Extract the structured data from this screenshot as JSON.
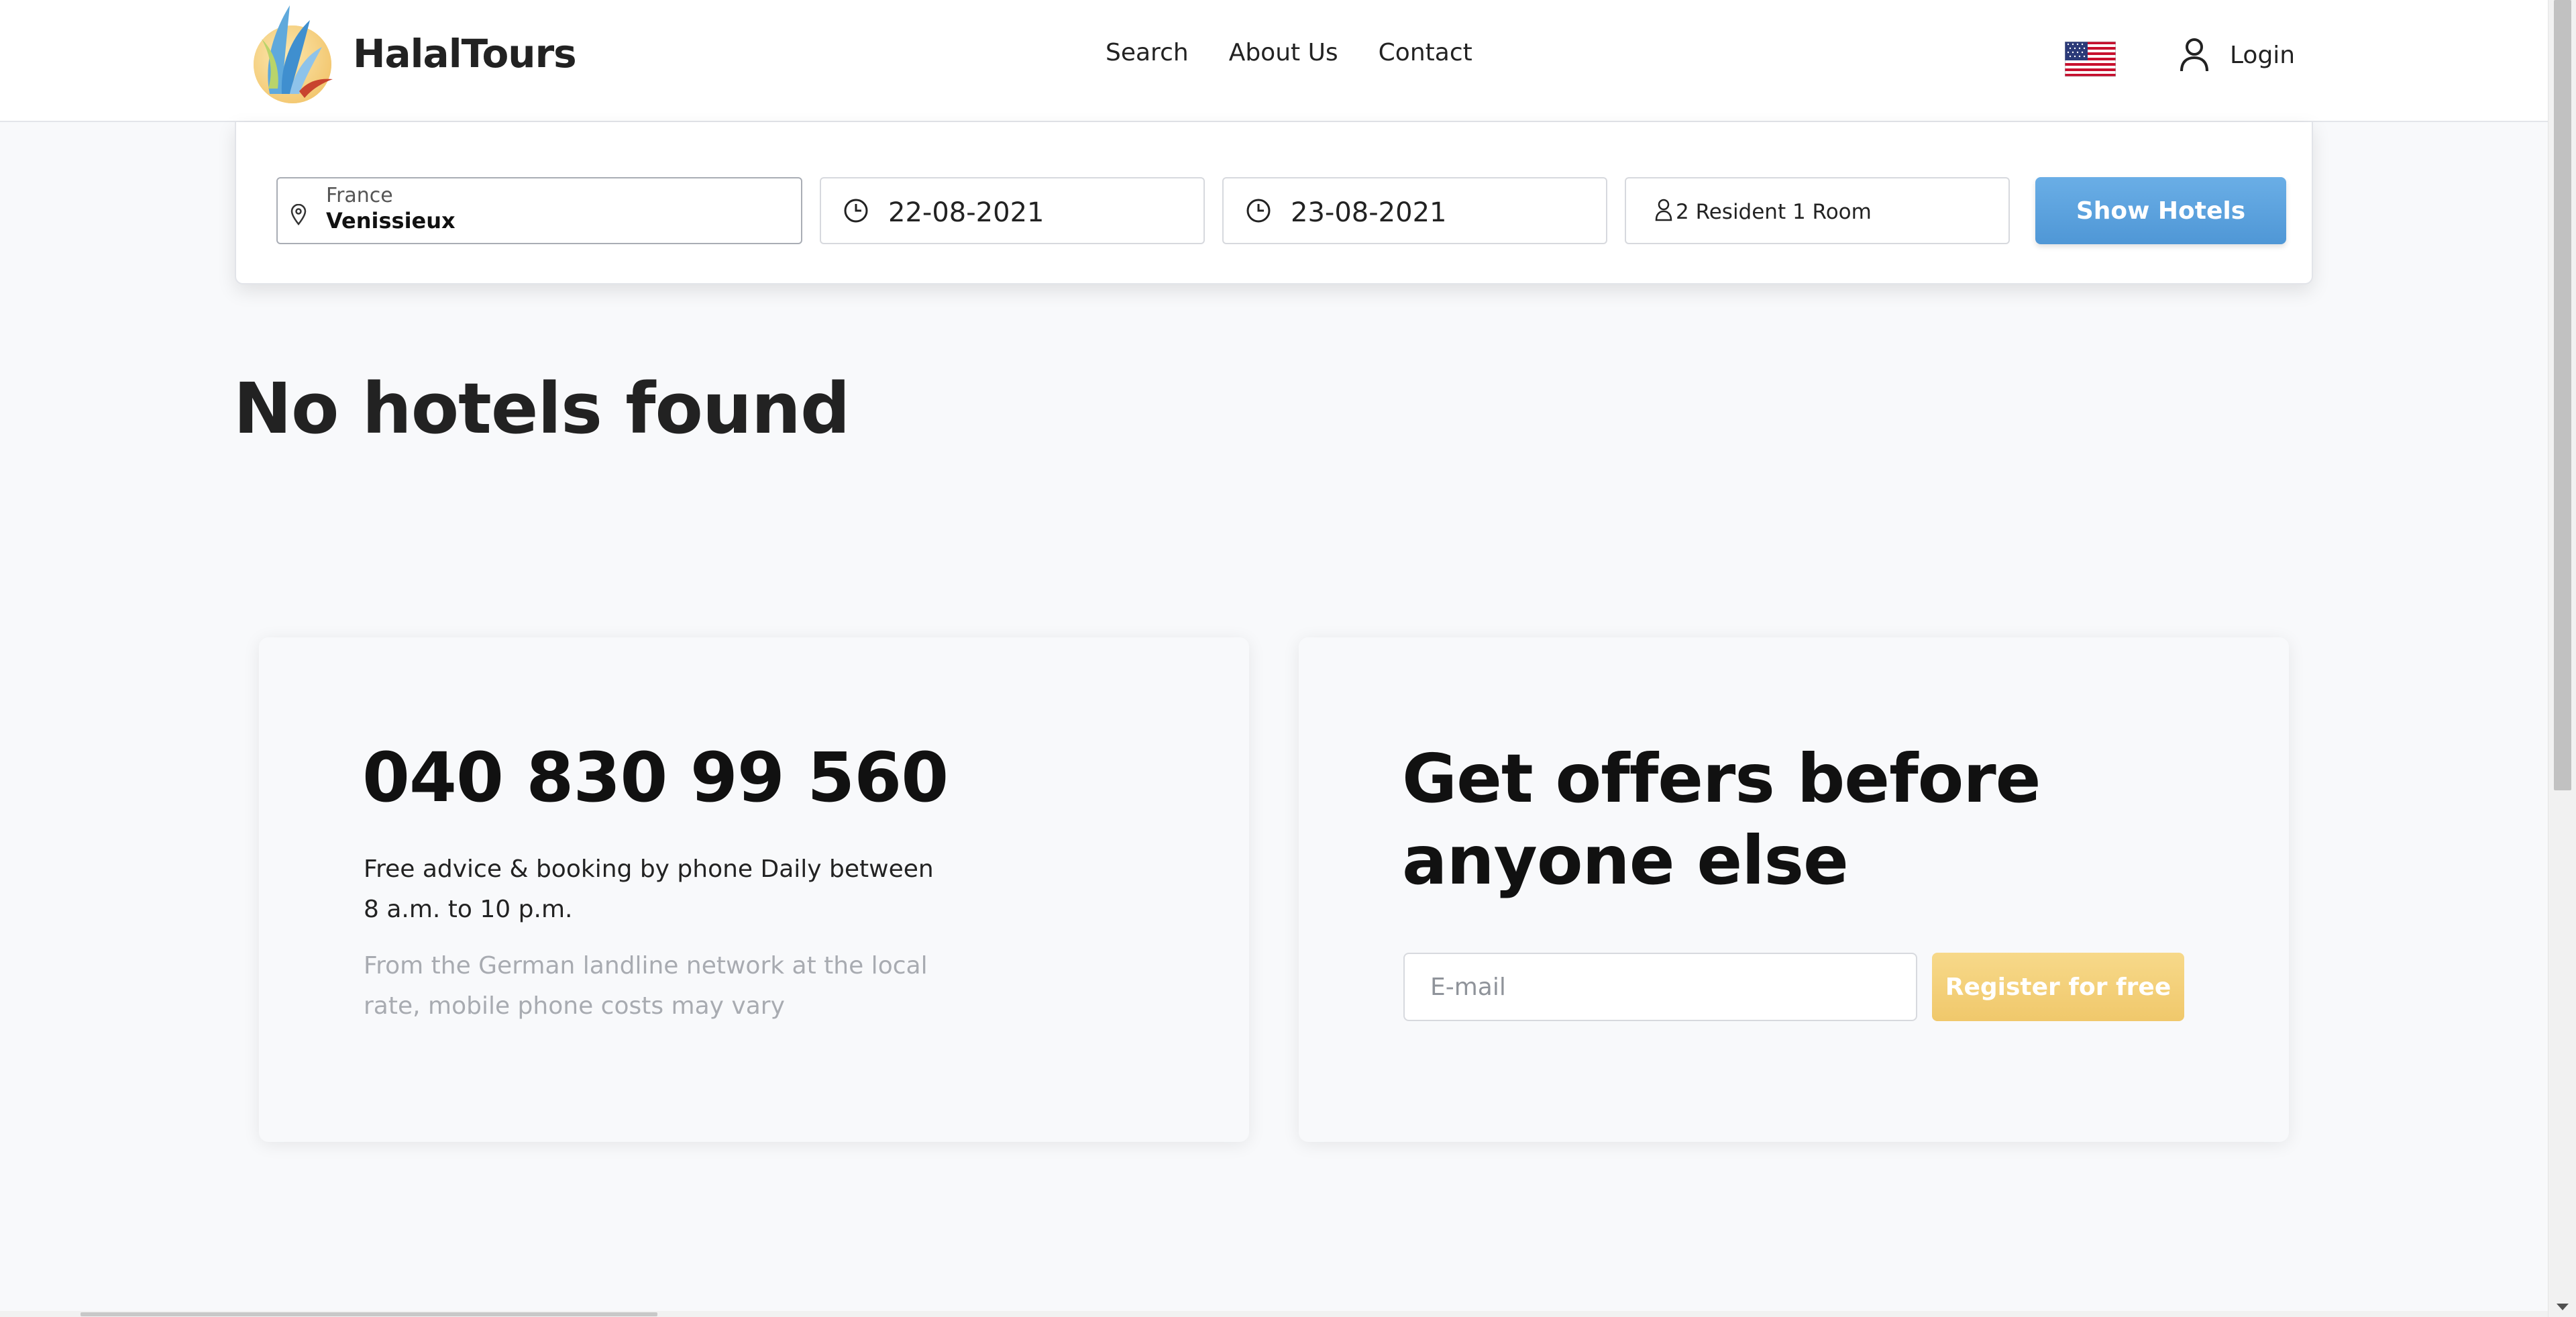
{
  "header": {
    "brand": "HalalTours",
    "nav": [
      {
        "label": "Search"
      },
      {
        "label": "About Us"
      },
      {
        "label": "Contact"
      }
    ],
    "language_flag": "us-flag-icon",
    "login_label": "Login"
  },
  "search": {
    "location_country": "France",
    "location_city": "Venissieux",
    "checkin": "22-08-2021",
    "checkout": "23-08-2021",
    "guests": "2 Resident 1 Room",
    "submit_label": "Show Hotels"
  },
  "results": {
    "message": "No hotels found"
  },
  "contact_card": {
    "phone": "040 830 99 560",
    "description": "Free advice & booking by phone Daily between 8 a.m. to 10 p.m.",
    "note": "From the German landline network at the local rate, mobile phone costs may vary"
  },
  "newsletter_card": {
    "title": "Get offers before anyone else",
    "email_placeholder": "E-mail",
    "register_label": "Register for free"
  },
  "colors": {
    "background": "#f8f9fb",
    "primary_button": "#5ba2dd",
    "register_button": "#f3cf78",
    "text": "#222222",
    "muted_text": "#a8abb1"
  }
}
